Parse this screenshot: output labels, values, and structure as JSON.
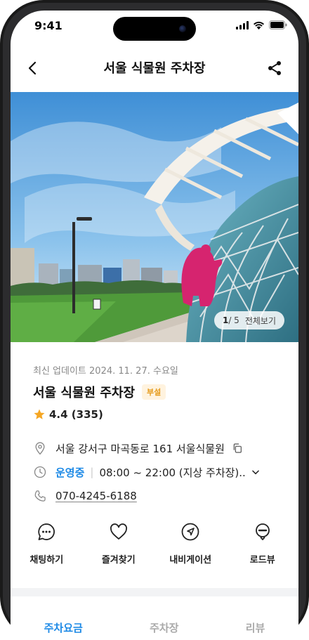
{
  "status_bar": {
    "time": "9:41"
  },
  "header": {
    "title": "서울 식물원 주차장"
  },
  "gallery": {
    "current": "1",
    "total": "/ 5",
    "view_all": "전체보기"
  },
  "place": {
    "updated": "최신 업데이트 2024. 11. 27. 수요일",
    "name": "서울 식물원 주차장",
    "badge": "부설",
    "rating": "4.4 (335)",
    "address": "서울 강서구 마곡동로 161 서울식물원",
    "status": "운영중",
    "hours": "08:00 ~ 22:00 (지상 주차장)..",
    "phone": "070-4245-6188"
  },
  "actions": [
    {
      "label": "채팅하기",
      "icon": "chat-icon"
    },
    {
      "label": "즐겨찾기",
      "icon": "heart-icon"
    },
    {
      "label": "내비게이션",
      "icon": "navigation-icon"
    },
    {
      "label": "로드뷰",
      "icon": "roadview-icon"
    }
  ],
  "tabs": [
    "주차요금",
    "주차장",
    "리뷰"
  ],
  "colors": {
    "accent": "#1e8ae6",
    "badge_text": "#e59a1a",
    "badge_bg": "#fff3df",
    "star": "#f5a623"
  }
}
